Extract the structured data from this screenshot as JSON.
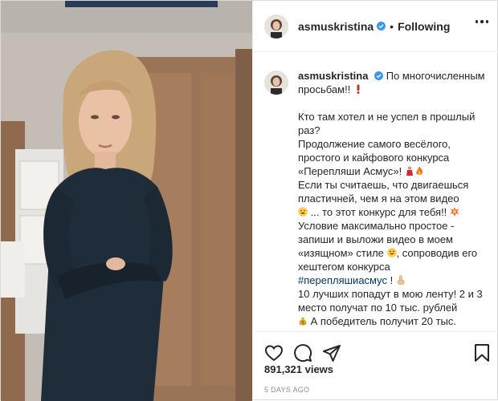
{
  "post": {
    "username": "asmuskristina",
    "dot": "•",
    "follow_state": "Following",
    "caption_intro": "По многочисленным просьбам!!",
    "caption_lines": [
      "Кто там хотел и не успел в прошлый раз?",
      "Продолжение самого весёлого, простого и кайфового конкурса «Перепляши Асмус»!",
      "Если ты считаешь, что двигаешься пластичней, чем я на этом видео",
      "... то этот конкурс для тебя!!",
      "Условие максимально простое - запиши и выложи видео в моем «изящном» стиле",
      ", сопроводив его хештегом конкурса",
      "#перепляшиасмус",
      " !",
      "10 лучших попадут в мою ленту! 2 и 3 место получат по 10 тыс. рублей",
      "А победитель получит 20 тыс."
    ],
    "views": "891,321 views",
    "posted_ago": "5 DAYS AGO"
  },
  "colors": {
    "verified": "#3897f0",
    "hashtag": "#00376b",
    "meta_gray": "#8e8e8e",
    "text": "#262626"
  },
  "icons": {
    "verified": "verified-badge-icon",
    "more": "more-options-icon",
    "like": "heart-icon",
    "comment": "comment-bubble-icon",
    "share": "paper-plane-icon",
    "save": "bookmark-icon"
  }
}
